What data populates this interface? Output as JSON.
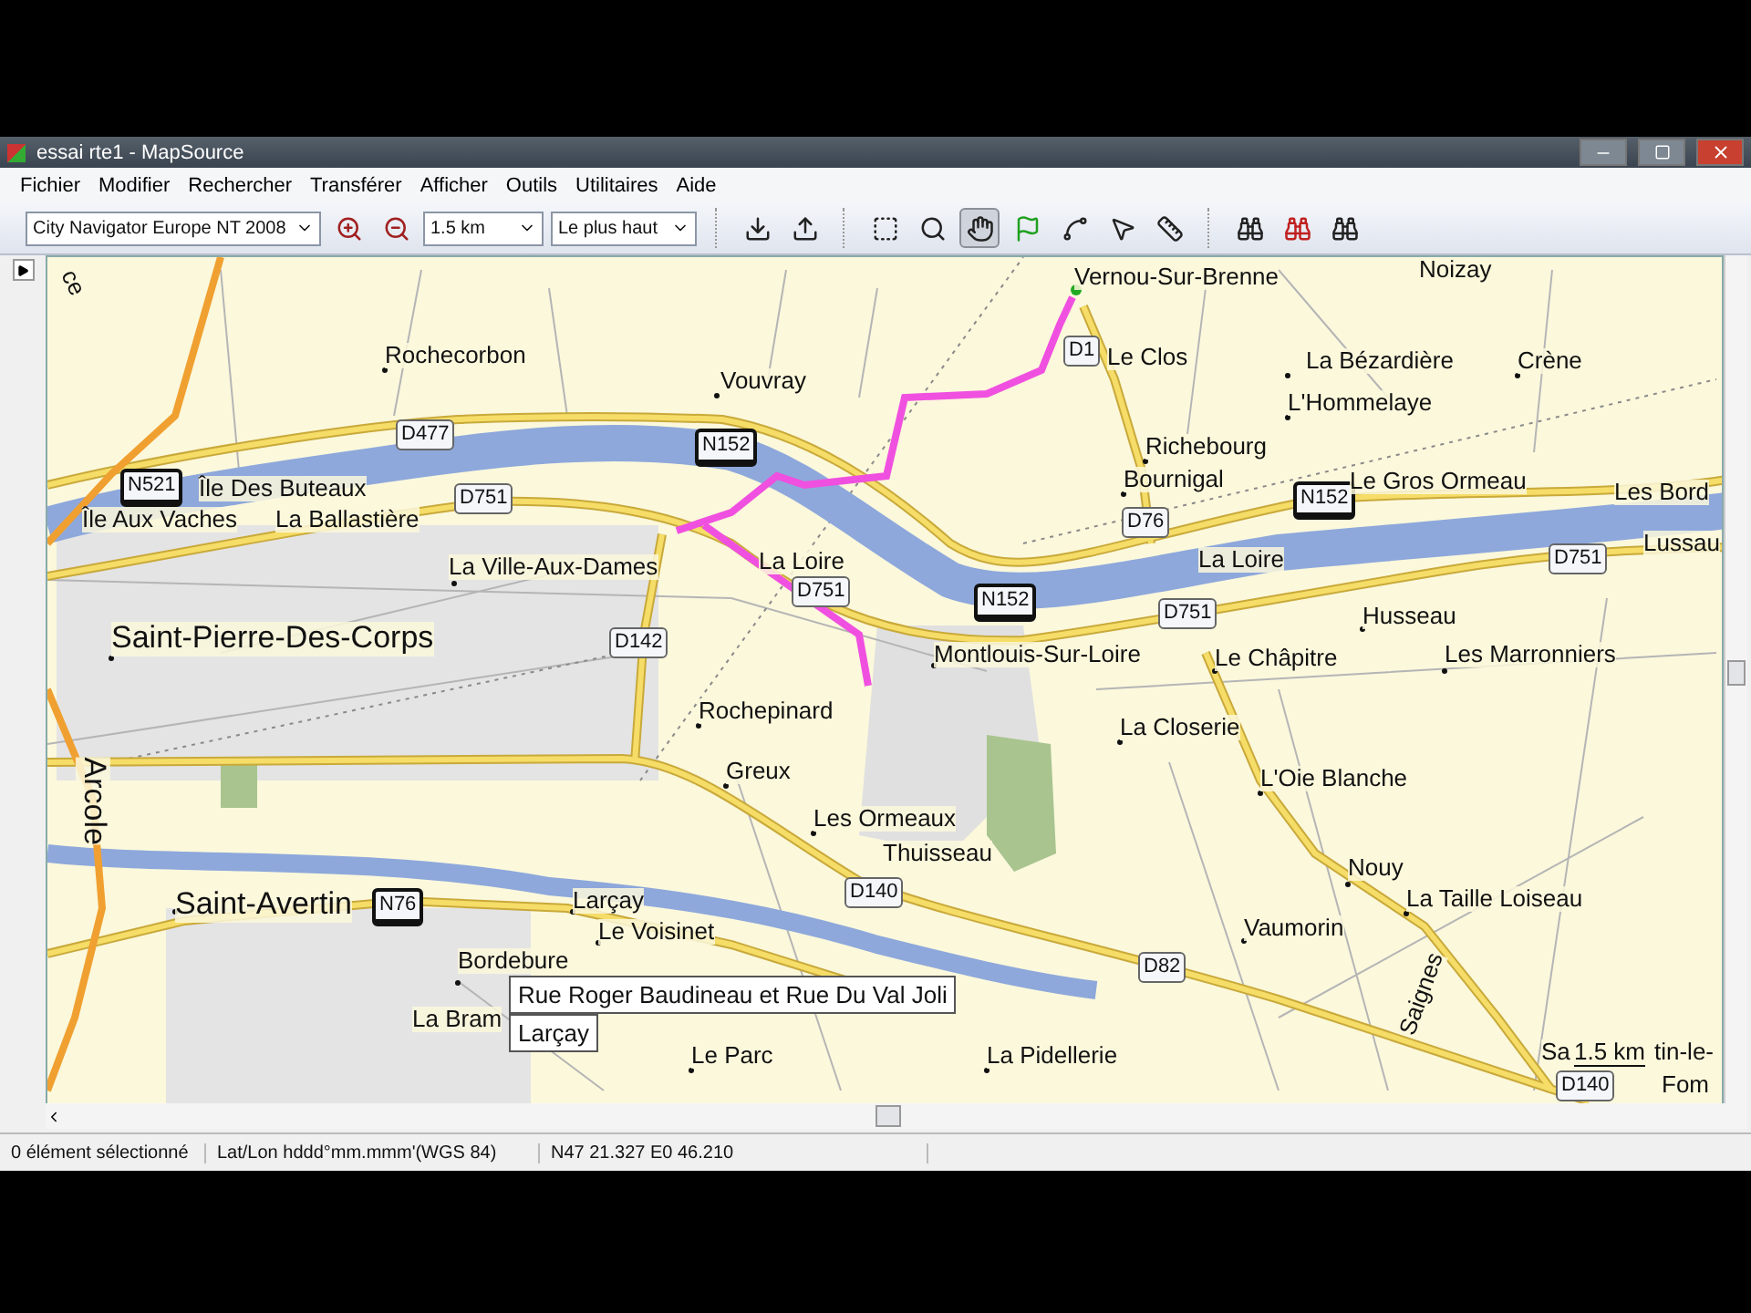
{
  "window": {
    "title": "essai rte1 - MapSource"
  },
  "menu": [
    "Fichier",
    "Modifier",
    "Rechercher",
    "Transférer",
    "Afficher",
    "Outils",
    "Utilitaires",
    "Aide"
  ],
  "toolbar": {
    "map_product": "City Navigator Europe NT 2008",
    "scale": "1.5 km",
    "detail": "Le plus haut",
    "tools": [
      {
        "kind": "receive",
        "selected": false
      },
      {
        "kind": "send",
        "selected": false
      },
      {
        "kind": "area",
        "selected": false
      },
      {
        "kind": "zoom",
        "selected": false
      },
      {
        "kind": "hand",
        "selected": true
      },
      {
        "kind": "waypoint",
        "selected": false
      },
      {
        "kind": "route",
        "selected": false
      },
      {
        "kind": "pointer",
        "selected": false
      },
      {
        "kind": "measure",
        "selected": false
      },
      {
        "kind": "find",
        "selected": false
      },
      {
        "kind": "find-near",
        "selected": false
      },
      {
        "kind": "find-next",
        "selected": false
      }
    ]
  },
  "map": {
    "labels": [
      {
        "text": "ce",
        "kind": "town"
      },
      {
        "text": "Rochecorbon",
        "kind": "town"
      },
      {
        "text": "Vouvray",
        "kind": "town"
      },
      {
        "text": "Île Des Buteaux",
        "kind": "town"
      },
      {
        "text": "Île Aux Vaches",
        "kind": "town"
      },
      {
        "text": "La Ballastière",
        "kind": "town"
      },
      {
        "text": "La Ville-Aux-Dames",
        "kind": "town"
      },
      {
        "text": "Saint-Pierre-Des-Corps",
        "kind": "city"
      },
      {
        "text": "La Loire",
        "kind": "town"
      },
      {
        "text": "Rochepinard",
        "kind": "town"
      },
      {
        "text": "Greux",
        "kind": "town"
      },
      {
        "text": "Les Ormeaux",
        "kind": "town"
      },
      {
        "text": "Thuisseau",
        "kind": "town"
      },
      {
        "text": "Arcole",
        "kind": "city"
      },
      {
        "text": "Saint-Avertin",
        "kind": "city"
      },
      {
        "text": "Larçay",
        "kind": "town"
      },
      {
        "text": "Le Voisinet",
        "kind": "town"
      },
      {
        "text": "Bordebure",
        "kind": "town"
      },
      {
        "text": "La Bram",
        "kind": "town"
      },
      {
        "text": "Le Parc",
        "kind": "town"
      },
      {
        "text": "Vernou-Sur-Brenne",
        "kind": "town"
      },
      {
        "text": "Noizay",
        "kind": "town"
      },
      {
        "text": "Le Clos",
        "kind": "town"
      },
      {
        "text": "La Bézardière",
        "kind": "town"
      },
      {
        "text": "Crène",
        "kind": "town"
      },
      {
        "text": "L'Hommelaye",
        "kind": "town"
      },
      {
        "text": "Richebourg",
        "kind": "town"
      },
      {
        "text": "Bournigal",
        "kind": "town"
      },
      {
        "text": "Le Gros Ormeau",
        "kind": "town"
      },
      {
        "text": "Les Bord",
        "kind": "town"
      },
      {
        "text": "La Loire",
        "kind": "town"
      },
      {
        "text": "Lussau",
        "kind": "town"
      },
      {
        "text": "Husseau",
        "kind": "town"
      },
      {
        "text": "Montlouis-Sur-Loire",
        "kind": "town"
      },
      {
        "text": "Le Châpitre",
        "kind": "town"
      },
      {
        "text": "Les Marronniers",
        "kind": "town"
      },
      {
        "text": "La Closerie",
        "kind": "town"
      },
      {
        "text": "L'Oie Blanche",
        "kind": "town"
      },
      {
        "text": "Nouy",
        "kind": "town"
      },
      {
        "text": "La Taille Loiseau",
        "kind": "town"
      },
      {
        "text": "Vaumorin",
        "kind": "town"
      },
      {
        "text": "Saignes",
        "kind": "town"
      },
      {
        "text": "La Pidellerie",
        "kind": "town"
      },
      {
        "text": "Sa",
        "kind": "town"
      },
      {
        "text": "tin-le-",
        "kind": "town"
      },
      {
        "text": "Fom",
        "kind": "town"
      }
    ],
    "shields": [
      {
        "text": "D477",
        "kind": "departmental"
      },
      {
        "text": "N521",
        "kind": "national"
      },
      {
        "text": "N152",
        "kind": "national"
      },
      {
        "text": "D751",
        "kind": "departmental"
      },
      {
        "text": "D751",
        "kind": "departmental"
      },
      {
        "text": "D142",
        "kind": "departmental"
      },
      {
        "text": "N152",
        "kind": "national"
      },
      {
        "text": "N76",
        "kind": "national"
      },
      {
        "text": "D140",
        "kind": "departmental"
      },
      {
        "text": "D1",
        "kind": "departmental"
      },
      {
        "text": "D76",
        "kind": "departmental"
      },
      {
        "text": "N152",
        "kind": "national"
      },
      {
        "text": "D751",
        "kind": "departmental"
      },
      {
        "text": "D751",
        "kind": "departmental"
      },
      {
        "text": "D82",
        "kind": "departmental"
      },
      {
        "text": "D140",
        "kind": "departmental"
      }
    ],
    "scale_bar": "1.5 km",
    "tooltip": [
      "Rue Roger Baudineau et Rue Du Val Joli",
      "Larçay"
    ]
  },
  "status_bar": [
    "0 élément sélectionné",
    "Lat/Lon hddd°mm.mmm'(WGS 84)",
    "N47 21.327 E0 46.210"
  ]
}
